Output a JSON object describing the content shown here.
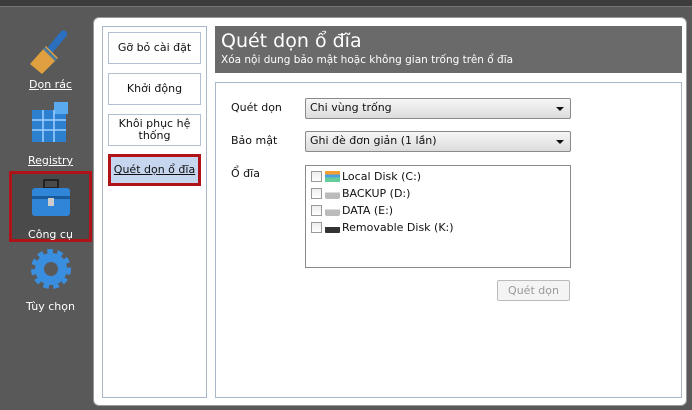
{
  "sidebar": {
    "items": [
      {
        "label": "Dọn rác",
        "icon": "broom-icon"
      },
      {
        "label": "Registry",
        "icon": "registry-cubes-icon"
      },
      {
        "label": "Công cụ",
        "icon": "toolbox-icon",
        "active": true
      },
      {
        "label": "Tùy chọn",
        "icon": "gear-icon"
      }
    ]
  },
  "nav": {
    "items": [
      {
        "label": "Gỡ bỏ cài đặt"
      },
      {
        "label": "Khởi động"
      },
      {
        "label": "Khôi phục hệ thống"
      },
      {
        "label": "Quét dọn ổ đĩa",
        "active": true
      }
    ]
  },
  "header": {
    "title": "Quét dọn ổ đĩa",
    "subtitle": "Xóa nội dung bảo mật hoặc không gian trống trên ổ đĩa"
  },
  "form": {
    "scan_label": "Quét dọn",
    "scan_value": "Chi vùng trống",
    "security_label": "Bảo mật",
    "security_value": "Ghi đè đơn giản (1 lần)",
    "drives_label": "Ổ đĩa",
    "drives": [
      {
        "label": "Local Disk (C:)",
        "checked": false
      },
      {
        "label": "BACKUP (D:)",
        "checked": false
      },
      {
        "label": "DATA (E:)",
        "checked": false
      },
      {
        "label": "Removable Disk (K:)",
        "checked": false
      }
    ],
    "scan_button": "Quét dọn"
  }
}
